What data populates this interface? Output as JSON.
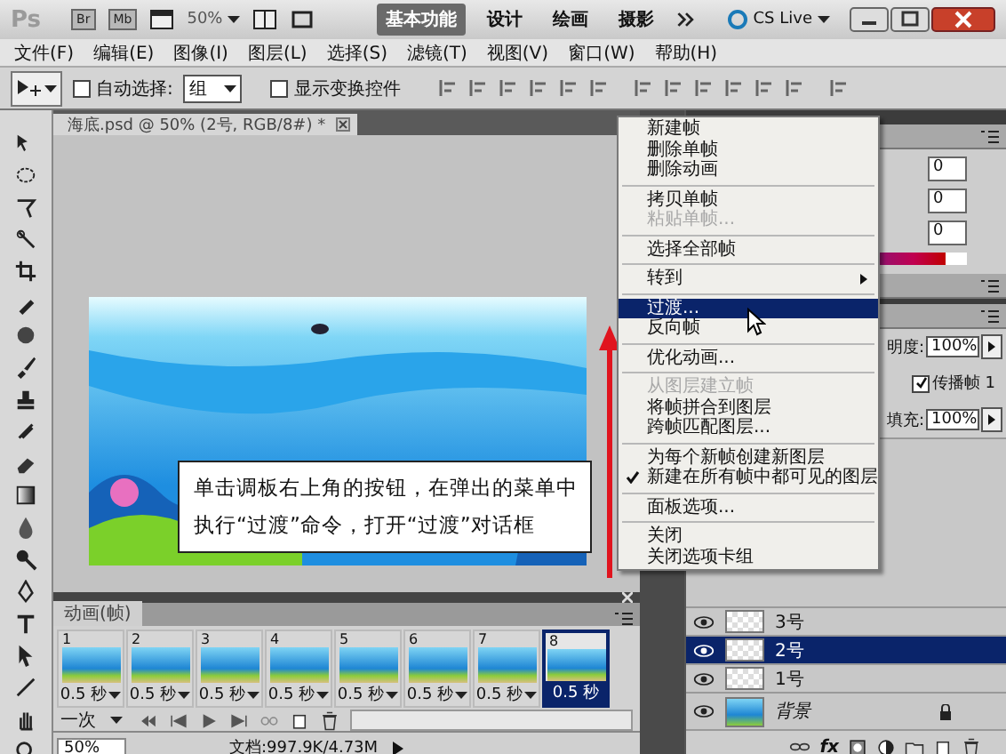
{
  "app_bar": {
    "logo": "Ps",
    "apps": [
      "Br",
      "Mb"
    ],
    "zoom": "50%",
    "workspaces": [
      {
        "label": "基本功能",
        "selected": true
      },
      {
        "label": "设计",
        "selected": false
      },
      {
        "label": "绘画",
        "selected": false
      },
      {
        "label": "摄影",
        "selected": false
      }
    ],
    "cs_live": "CS Live"
  },
  "menu_bar": [
    "文件(F)",
    "编辑(E)",
    "图像(I)",
    "图层(L)",
    "选择(S)",
    "滤镜(T)",
    "视图(V)",
    "窗口(W)",
    "帮助(H)"
  ],
  "options_bar": {
    "auto_select": {
      "label": "自动选择:",
      "checked": false
    },
    "auto_select_target": "组",
    "show_transform": {
      "label": "显示变换控件",
      "checked": false
    }
  },
  "document_tab": {
    "title": "海底.psd @ 50% (2号, RGB/8#) *"
  },
  "callout": {
    "lines": [
      "单击调板右上角的按钮，在弹出的菜单中",
      "执行“过渡”命令，打开“过渡”对话框"
    ]
  },
  "animation_panel": {
    "title": "动画(帧)",
    "loop": "一次",
    "frames": [
      {
        "number": "1",
        "delay": "0.5 秒",
        "selected": false
      },
      {
        "number": "2",
        "delay": "0.5 秒",
        "selected": false
      },
      {
        "number": "3",
        "delay": "0.5 秒",
        "selected": false
      },
      {
        "number": "4",
        "delay": "0.5 秒",
        "selected": false
      },
      {
        "number": "5",
        "delay": "0.5 秒",
        "selected": false
      },
      {
        "number": "6",
        "delay": "0.5 秒",
        "selected": false
      },
      {
        "number": "7",
        "delay": "0.5 秒",
        "selected": false
      },
      {
        "number": "8",
        "delay": "0.5 秒",
        "selected": true
      }
    ]
  },
  "status_bar": {
    "zoom": "50%",
    "doc_info": "文档:997.9K/4.73M"
  },
  "color_panel": {
    "values": [
      "0",
      "0",
      "0"
    ]
  },
  "layers_panel": {
    "opacity_label": "明度:",
    "opacity": "100%",
    "propagate": {
      "label": "传播帧 1",
      "checked": true
    },
    "fill_label": "填充:",
    "fill": "100%",
    "fx": "fx",
    "layers": [
      {
        "name": "3号",
        "kind": "layer",
        "selected": false,
        "locked": false
      },
      {
        "name": "2号",
        "kind": "layer",
        "selected": true,
        "locked": false
      },
      {
        "name": "1号",
        "kind": "layer",
        "selected": false,
        "locked": false
      },
      {
        "name": "背景",
        "kind": "background",
        "selected": false,
        "locked": true
      }
    ]
  },
  "context_menu": {
    "items": [
      {
        "kind": "item",
        "label": "新建帧",
        "disabled": false,
        "checked": false,
        "selected": false,
        "submenu": false
      },
      {
        "kind": "item",
        "label": "删除单帧",
        "disabled": false,
        "checked": false,
        "selected": false,
        "submenu": false
      },
      {
        "kind": "item",
        "label": "删除动画",
        "disabled": false,
        "checked": false,
        "selected": false,
        "submenu": false
      },
      {
        "kind": "separator"
      },
      {
        "kind": "item",
        "label": "拷贝单帧",
        "disabled": false,
        "checked": false,
        "selected": false,
        "submenu": false
      },
      {
        "kind": "item",
        "label": "粘贴单帧...",
        "disabled": true,
        "checked": false,
        "selected": false,
        "submenu": false
      },
      {
        "kind": "separator"
      },
      {
        "kind": "item",
        "label": "选择全部帧",
        "disabled": false,
        "checked": false,
        "selected": false,
        "submenu": false
      },
      {
        "kind": "separator"
      },
      {
        "kind": "item",
        "label": "转到",
        "disabled": false,
        "checked": false,
        "selected": false,
        "submenu": true
      },
      {
        "kind": "separator"
      },
      {
        "kind": "item",
        "label": "过渡...",
        "disabled": false,
        "checked": false,
        "selected": true,
        "submenu": false
      },
      {
        "kind": "item",
        "label": "反向帧",
        "disabled": false,
        "checked": false,
        "selected": false,
        "submenu": false
      },
      {
        "kind": "separator"
      },
      {
        "kind": "item",
        "label": "优化动画...",
        "disabled": false,
        "checked": false,
        "selected": false,
        "submenu": false
      },
      {
        "kind": "separator"
      },
      {
        "kind": "item",
        "label": "从图层建立帧",
        "disabled": true,
        "checked": false,
        "selected": false,
        "submenu": false
      },
      {
        "kind": "item",
        "label": "将帧拼合到图层",
        "disabled": false,
        "checked": false,
        "selected": false,
        "submenu": false
      },
      {
        "kind": "item",
        "label": "跨帧匹配图层...",
        "disabled": false,
        "checked": false,
        "selected": false,
        "submenu": false
      },
      {
        "kind": "separator"
      },
      {
        "kind": "item",
        "label": "为每个新帧创建新图层",
        "disabled": false,
        "checked": false,
        "selected": false,
        "submenu": false
      },
      {
        "kind": "item",
        "label": "新建在所有帧中都可见的图层",
        "disabled": false,
        "checked": true,
        "selected": false,
        "submenu": false
      },
      {
        "kind": "separator"
      },
      {
        "kind": "item",
        "label": "面板选项...",
        "disabled": false,
        "checked": false,
        "selected": false,
        "submenu": false
      },
      {
        "kind": "separator"
      },
      {
        "kind": "item",
        "label": "关闭",
        "disabled": false,
        "checked": false,
        "selected": false,
        "submenu": false
      },
      {
        "kind": "item",
        "label": "关闭选项卡组",
        "disabled": false,
        "checked": false,
        "selected": false,
        "submenu": false
      }
    ]
  }
}
